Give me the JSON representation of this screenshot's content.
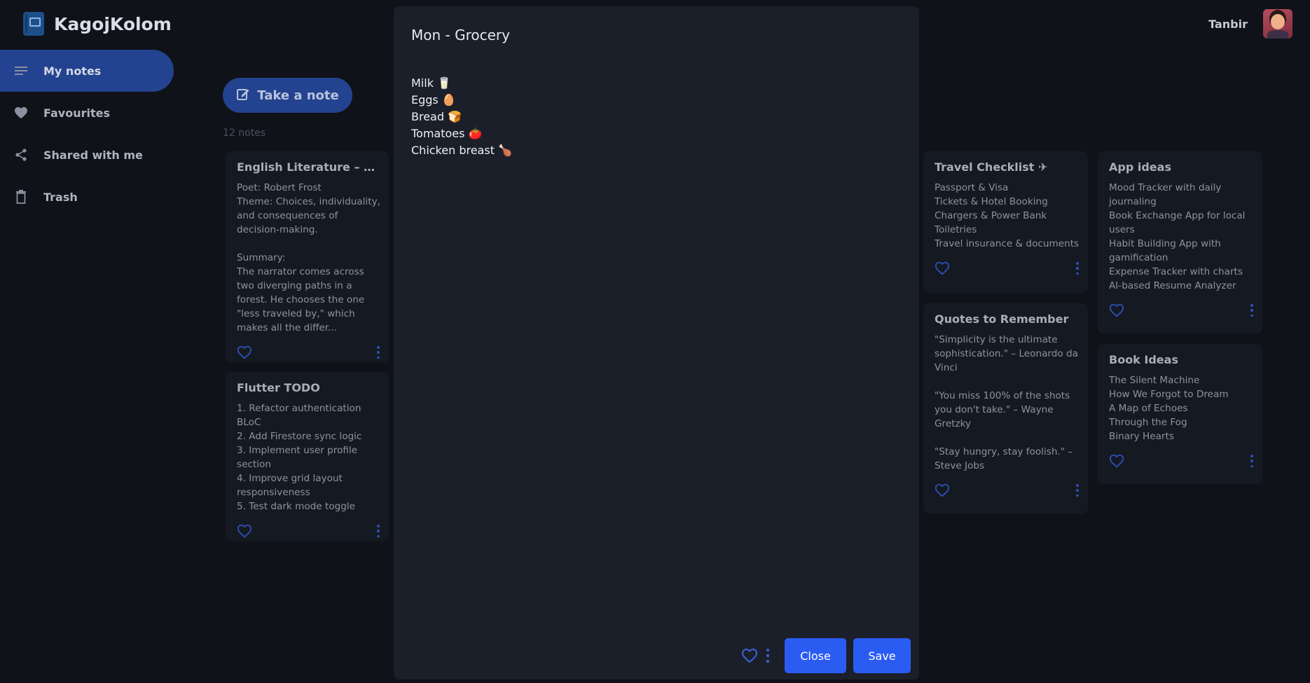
{
  "app": {
    "name": "KagojKolom"
  },
  "user": {
    "name": "Tanbir"
  },
  "sidebar": {
    "items": [
      {
        "label": "My notes",
        "icon": "menu-icon"
      },
      {
        "label": "Favourites",
        "icon": "heart-icon"
      },
      {
        "label": "Shared with me",
        "icon": "share-icon"
      },
      {
        "label": "Trash",
        "icon": "trash-icon"
      }
    ]
  },
  "main": {
    "take_note_label": "Take a note",
    "notes_count": "12 notes"
  },
  "cards": [
    {
      "title": "English Literature – The R...",
      "body": "Poet: Robert Frost\nTheme: Choices, individuality, and consequences of decision-making.\n\nSummary:\nThe narrator comes across two diverging paths in a forest. He chooses the one \"less traveled by,\" which makes all the differ..."
    },
    {
      "title": "Flutter TODO",
      "body": "1. Refactor authentication BLoC\n2. Add Firestore sync logic\n3. Implement user profile section\n4. Improve grid layout responsiveness\n5. Test dark mode toggle"
    },
    {
      "title": "Travel Checklist ✈",
      "body": "Passport & Visa\nTickets & Hotel Booking\nChargers & Power Bank\nToiletries\nTravel insurance & documents"
    },
    {
      "title": "Quotes to Remember",
      "body": "\"Simplicity is the ultimate sophistication.\" – Leonardo da Vinci\n\n\"You miss 100% of the shots you don't take.\" – Wayne Gretzky\n\n\"Stay hungry, stay foolish.\" – Steve Jobs"
    },
    {
      "title": "App ideas",
      "body": "Mood Tracker with daily journaling\nBook Exchange App for local users\nHabit Building App with gamification\nExpense Tracker with charts\nAI-based Resume Analyzer"
    },
    {
      "title": "Book Ideas",
      "body": "The Silent Machine\nHow We Forgot to Dream\nA Map of Echoes\nThrough the Fog\nBinary Hearts"
    }
  ],
  "modal": {
    "title": "Mon - Grocery",
    "body": "Milk 🥛\nEggs 🥚\nBread 🍞\nTomatoes 🍅\nChicken breast 🍗",
    "close_label": "Close",
    "save_label": "Save"
  },
  "colors": {
    "accent": "#2b5cf2",
    "nav_active": "#23428f",
    "background": "#0f1218",
    "modal_bg": "#1a1f2a",
    "card_bg": "#151a22"
  }
}
